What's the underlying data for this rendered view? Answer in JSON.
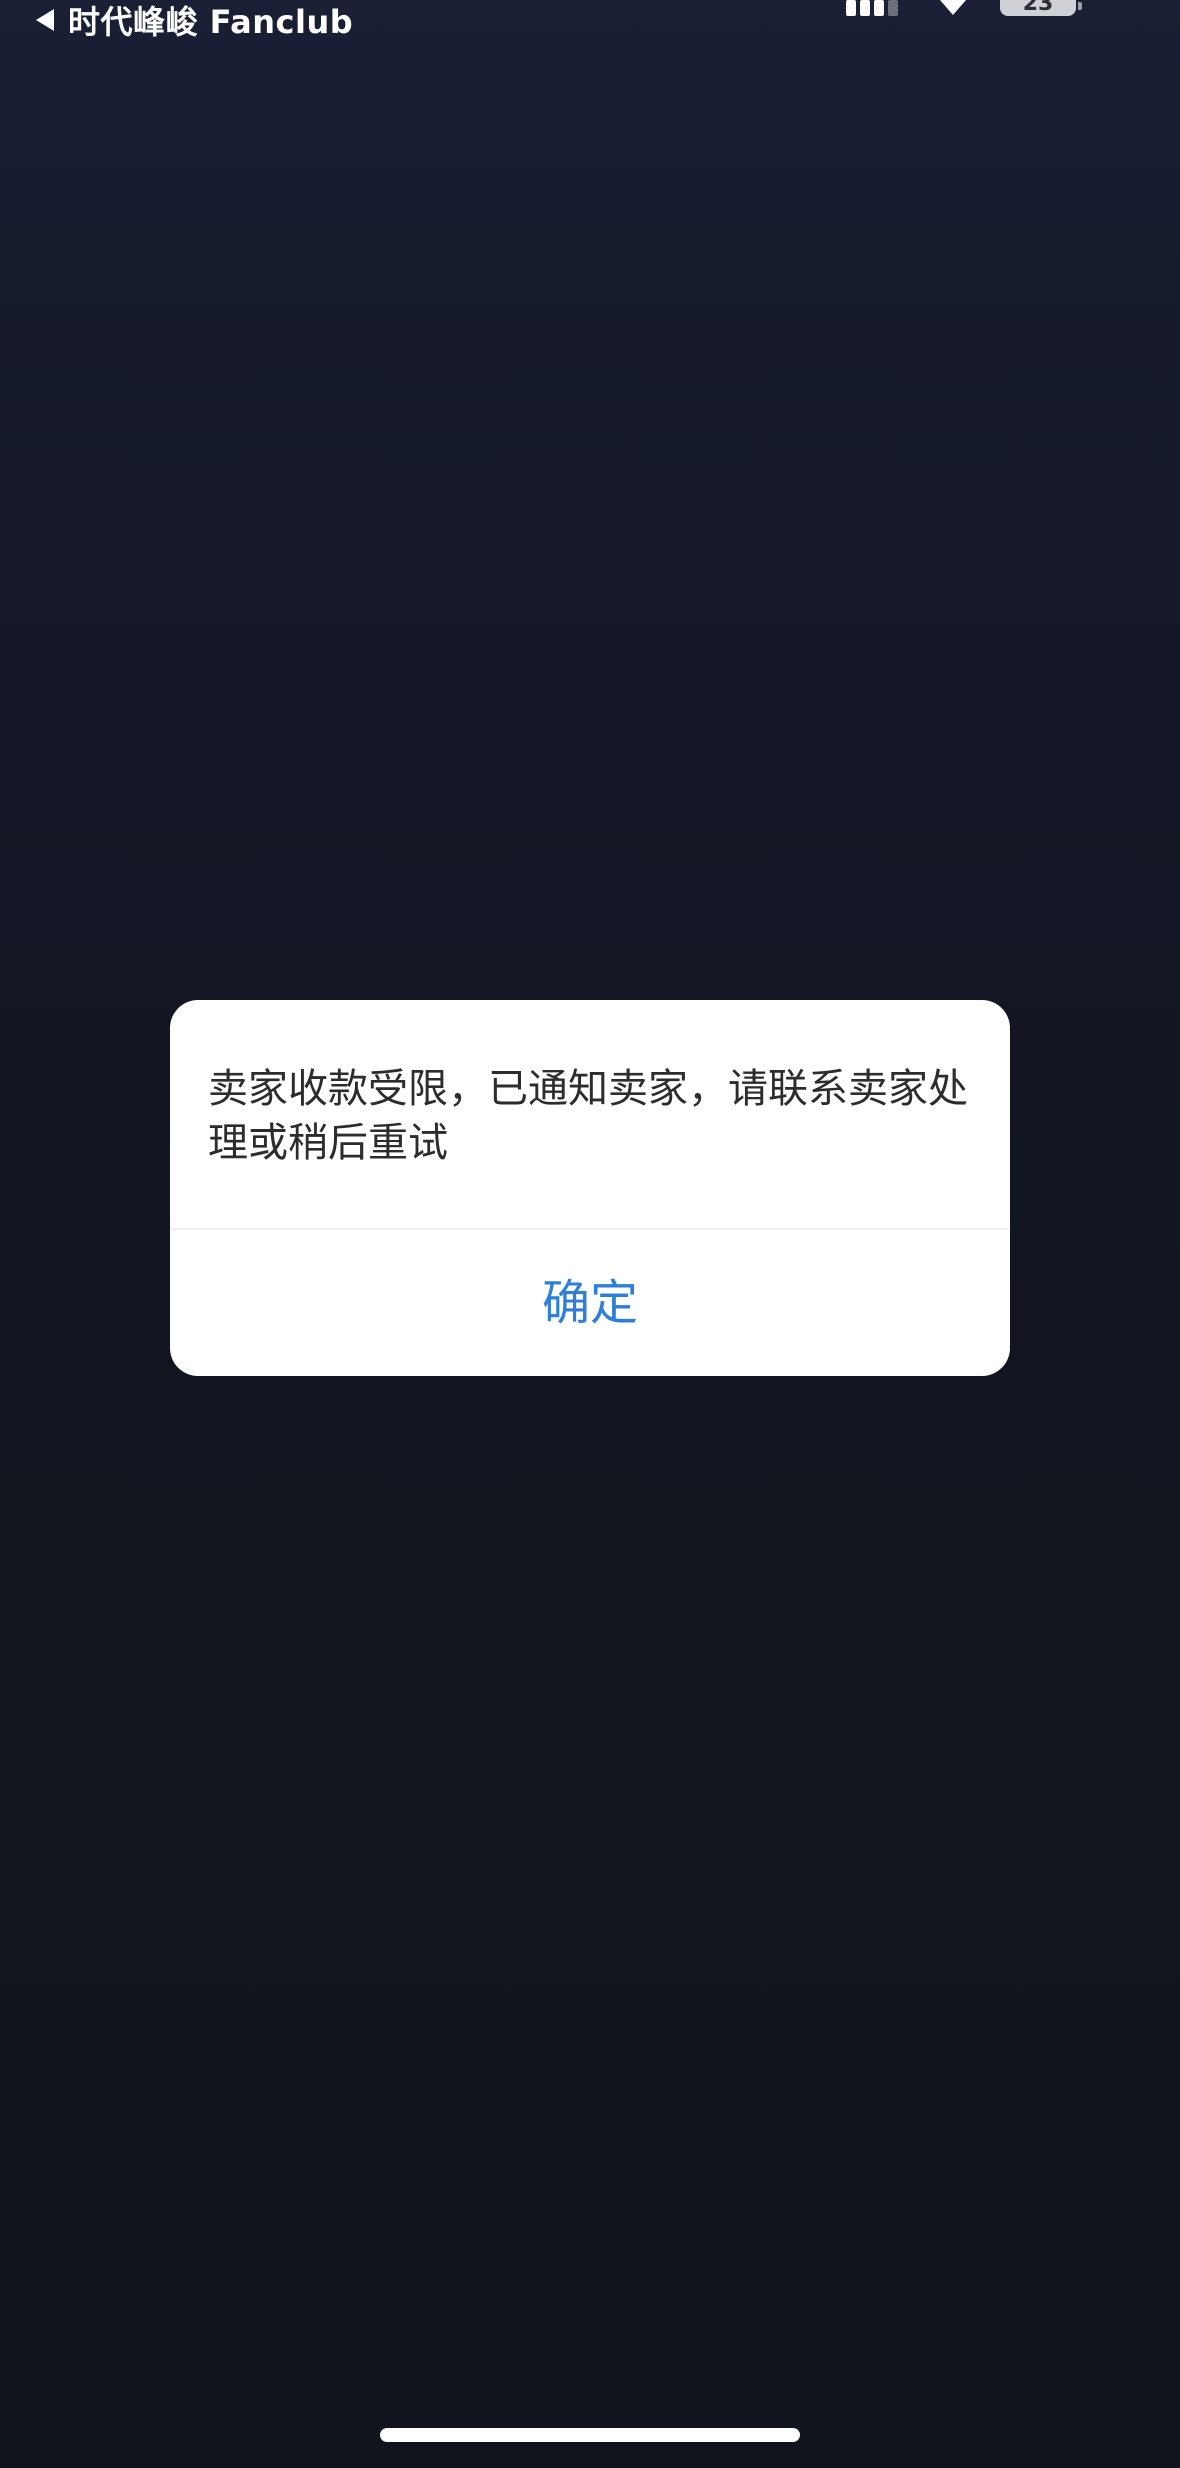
{
  "status_bar": {
    "back_app_label": "时代峰峻 Fanclub",
    "battery_level": "23"
  },
  "icons": {
    "back": "back-arrow-icon",
    "signal": "cellular-signal-icon",
    "wifi": "wifi-icon",
    "battery": "battery-icon"
  },
  "dialog": {
    "message": "卖家收款受限，已通知卖家，请联系卖家处理或稍后重试",
    "confirm_label": "确定"
  },
  "colors": {
    "background": "#12151f",
    "dialog_background": "#ffffff",
    "accent": "#2f7fd6"
  }
}
